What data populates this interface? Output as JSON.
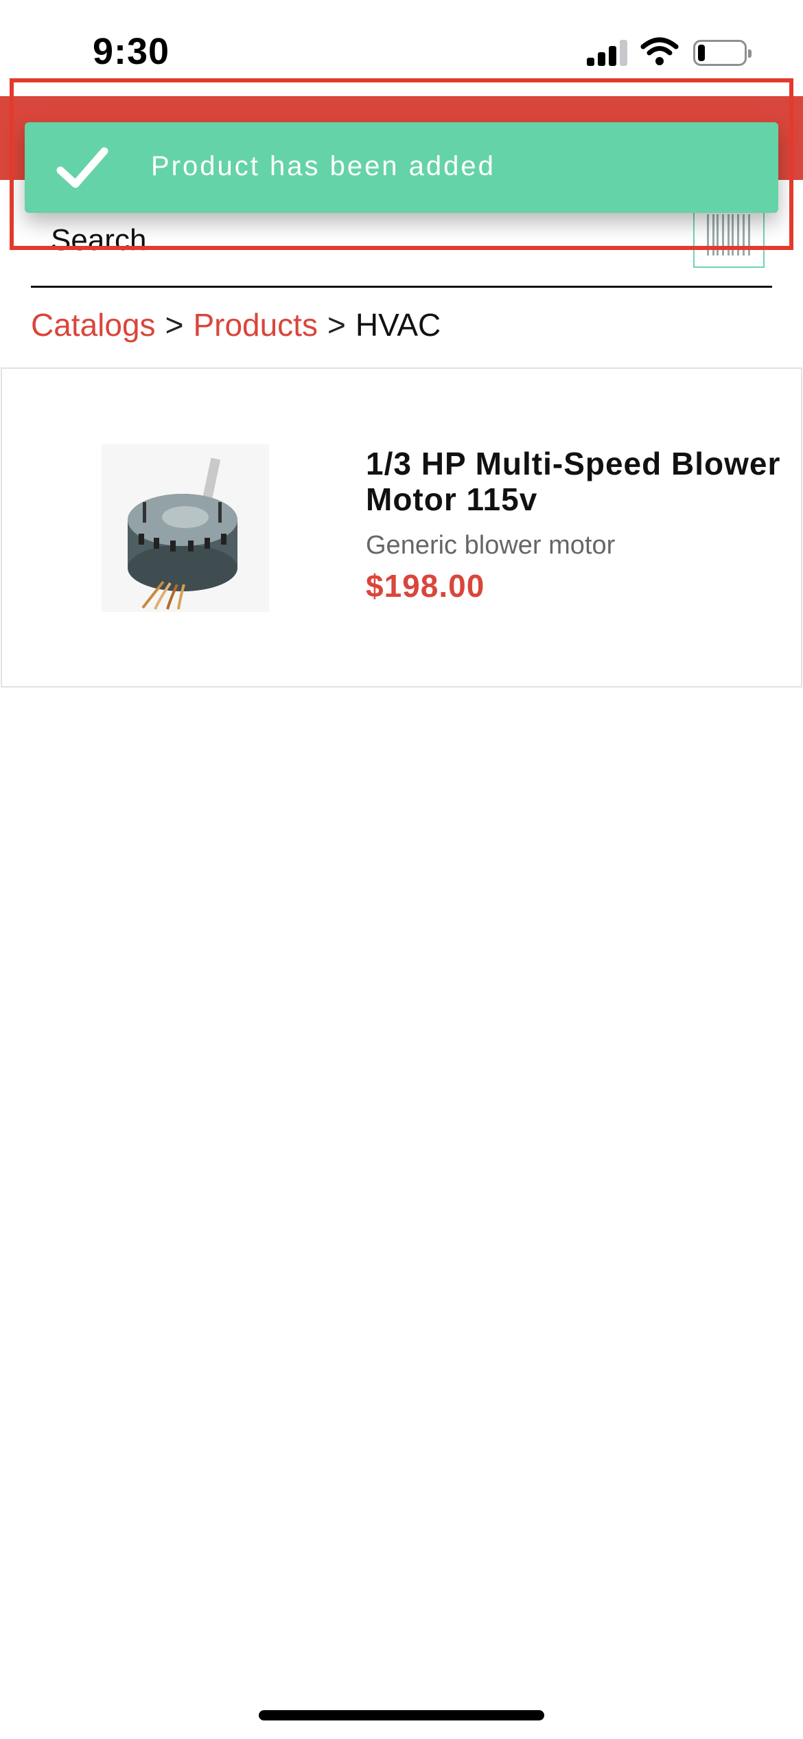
{
  "status_bar": {
    "time": "9:30",
    "signal_icon": "cellular-signal-icon",
    "wifi_icon": "wifi-icon",
    "battery_icon": "battery-icon",
    "battery_level": 0.15
  },
  "toast": {
    "icon": "checkmark-icon",
    "message": "Product has been added",
    "color": "#65d3a8"
  },
  "header": {
    "color": "#d9463b"
  },
  "search": {
    "placeholder": "Search...",
    "value": "",
    "barcode_icon": "barcode-scan-icon"
  },
  "breadcrumb": {
    "items": [
      {
        "label": "Catalogs"
      },
      {
        "label": "Products"
      },
      {
        "label": "HVAC"
      }
    ],
    "separator": ">"
  },
  "products": [
    {
      "name": "1/3 HP Multi-Speed Blower Motor 115v",
      "description": "Generic blower motor",
      "price": "$198.00",
      "image": "blower-motor-image"
    }
  ],
  "colors": {
    "accent": "#d9463b",
    "success": "#65d3a8",
    "highlight": "#e23a2c"
  }
}
